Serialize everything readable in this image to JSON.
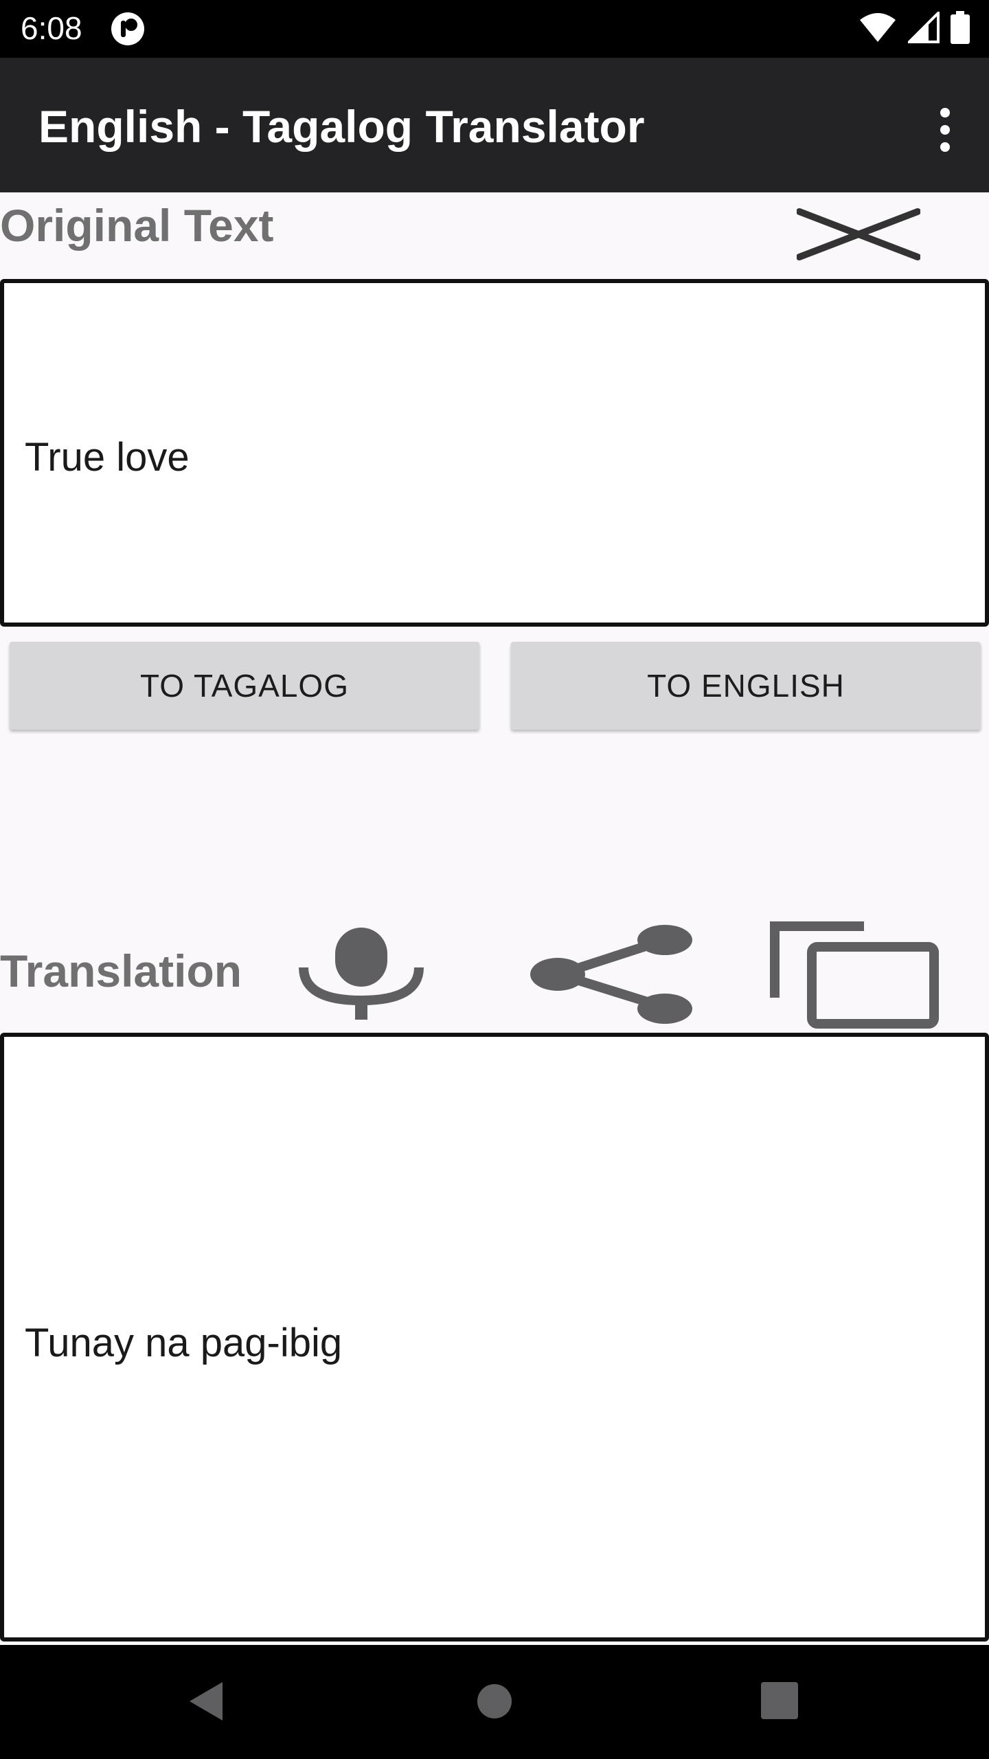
{
  "status_bar": {
    "time": "6:08",
    "icons": [
      "app-notification-icon",
      "wifi-icon",
      "signal-icon",
      "battery-icon"
    ]
  },
  "app_bar": {
    "title": "English - Tagalog Translator",
    "menu_icon": "more-vert-icon"
  },
  "original": {
    "label": "Original Text",
    "text": "True love",
    "clear_icon": "clear-icon"
  },
  "buttons": {
    "to_tagalog": "TO TAGALOG",
    "to_english": "TO ENGLISH"
  },
  "translation": {
    "label": "Translation",
    "text": "Tunay na pag-ibig",
    "icons": [
      "microphone-icon",
      "share-icon",
      "copy-icon"
    ]
  },
  "nav_bar": {
    "icons": [
      "back-icon",
      "home-icon",
      "recents-icon"
    ]
  },
  "colors": {
    "app_bar": "#232225",
    "background": "#faf8fb",
    "label_gray": "#707070",
    "icon_gray": "#5f5e61",
    "button": "#d7d7d9"
  }
}
